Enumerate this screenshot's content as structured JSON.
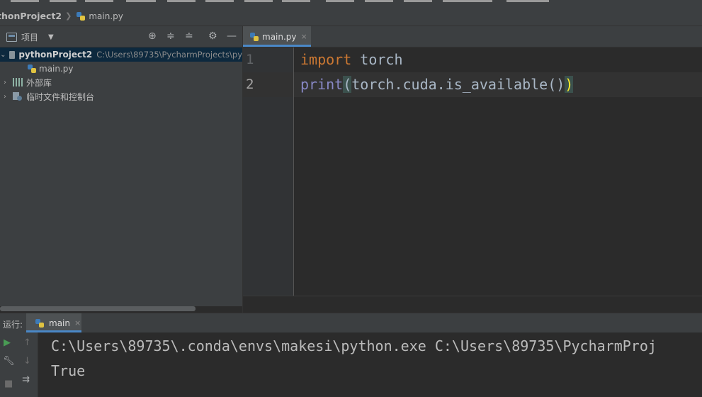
{
  "navbar": {
    "project": "thonProject2",
    "file": "main.py"
  },
  "project_panel": {
    "title": "项目",
    "tree": {
      "root_name": "pythonProject2",
      "root_path": "C:\\Users\\89735\\PycharmProjects\\py",
      "file": "main.py",
      "external_libs": "外部库",
      "scratches": "临时文件和控制台"
    }
  },
  "editor": {
    "tab_label": "main.py",
    "lines": [
      {
        "number": "1",
        "keyword": "import",
        "rest": " torch"
      },
      {
        "number": "2",
        "builtin": "print",
        "open": "(",
        "middle": "torch.cuda.is_available()",
        "close": ")"
      }
    ]
  },
  "run": {
    "label": "运行:",
    "tab_label": "main",
    "output": [
      "C:\\Users\\89735\\.conda\\envs\\makesi\\python.exe C:\\Users\\89735\\PycharmProj",
      "True"
    ]
  },
  "colors": {
    "background": "#2b2b2b",
    "panel": "#3c3f41",
    "keyword": "#cc7832",
    "builtin": "#8888c6",
    "accent": "#4a88c7",
    "run_green": "#499c54"
  }
}
